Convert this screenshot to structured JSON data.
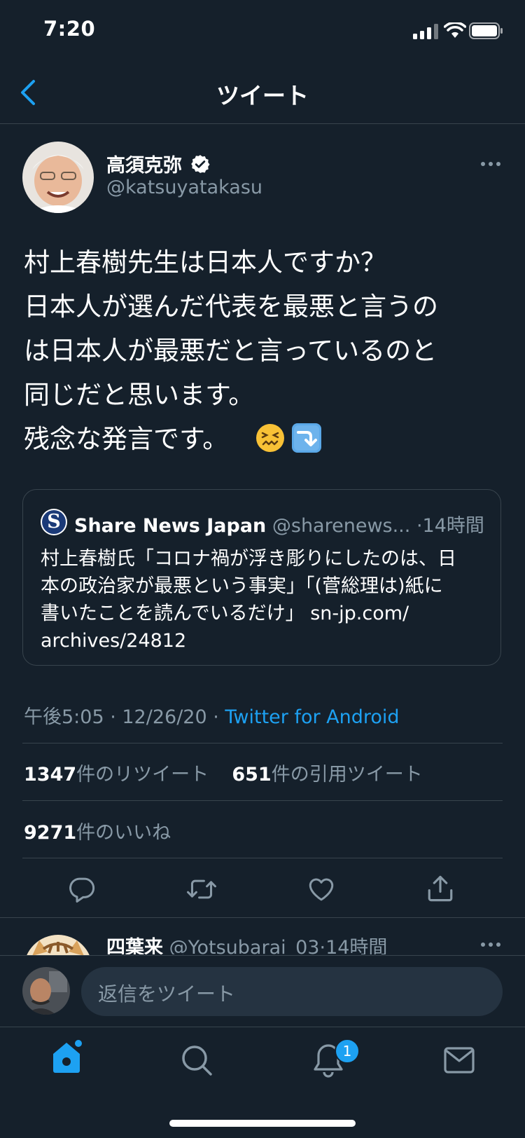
{
  "status_bar": {
    "time": "7:20"
  },
  "header": {
    "title": "ツイート"
  },
  "tweet": {
    "author_name": "高須克弥",
    "author_handle": "@katsuyatakasu",
    "text_lines": [
      "村上春樹先生は日本人ですか？",
      "日本人が選んだ代表を最悪と言うの",
      "は日本人が最悪だと言っているのと",
      "同じだと思います。",
      "残念な発言です。"
    ],
    "emoji": [
      "😖",
      "⤵️"
    ],
    "quoted": {
      "logo_letter": "S",
      "name": "Share News Japan",
      "handle": "@sharenews...",
      "sep": "·",
      "time": "14時間",
      "lines": [
        "村上春樹氏「コロナ禍が浮き彫りにしたのは、日",
        "本の政治家が最悪という事実」「(菅総理は)紙に",
        "書いたことを読んでいるだけ」 sn-jp.com/",
        "archives/24812"
      ]
    },
    "timestamp": "午後5:05 · 12/26/20 · ",
    "source": "Twitter for Android",
    "retweets_count": "1347",
    "retweets_label": "件のリツイート",
    "quotes_count": "651",
    "quotes_label": "件の引用ツイート",
    "likes_count": "9271",
    "likes_label": "件のいいね"
  },
  "reply": {
    "name": "四葉来",
    "handle": "@Yotsubarai_03",
    "sep": "·",
    "time": "14時間"
  },
  "composer": {
    "placeholder": "返信をツイート"
  },
  "tabbar": {
    "notification_badge": "1"
  },
  "colors": {
    "background": "#15202b",
    "accent": "#1da1f2",
    "muted": "#8899a6",
    "divider": "#38444d"
  }
}
